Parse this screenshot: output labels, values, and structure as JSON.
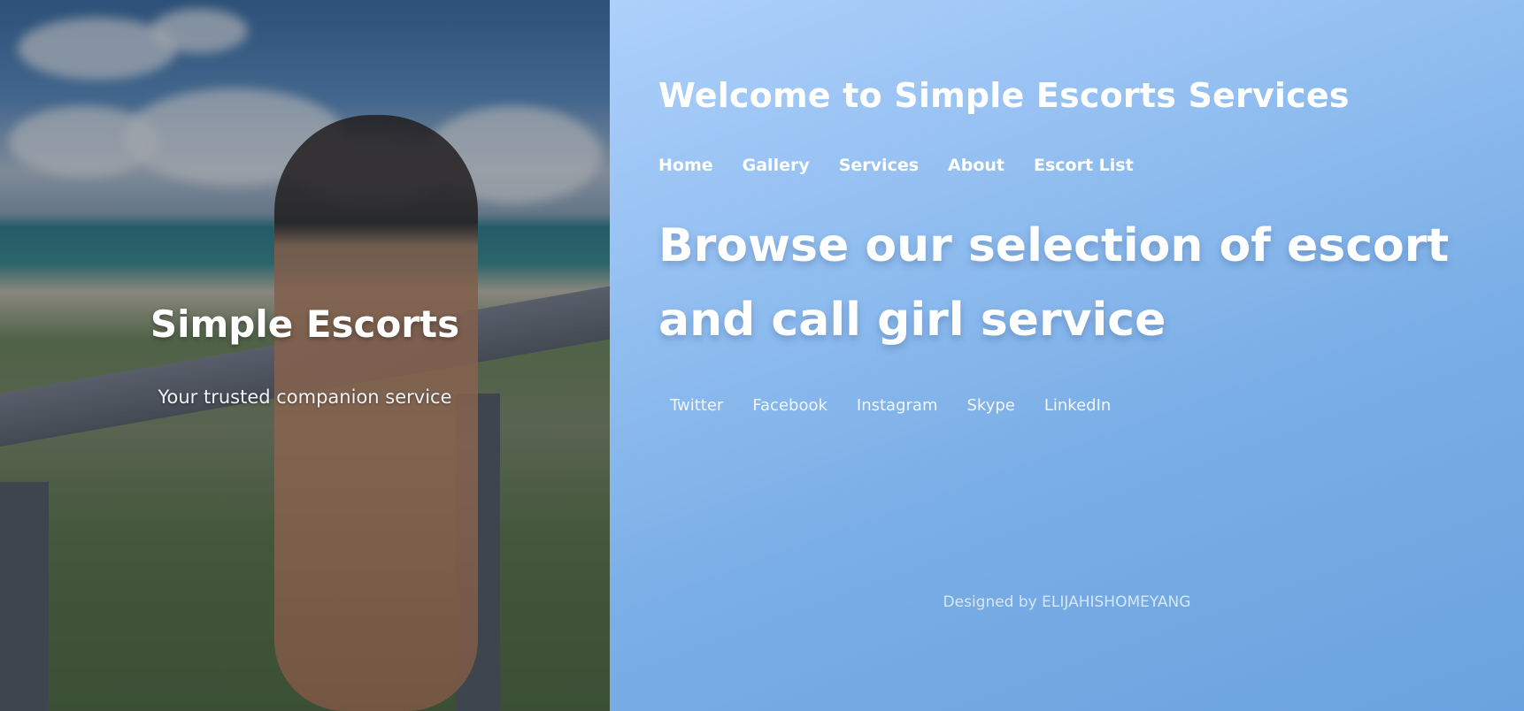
{
  "hero": {
    "title": "Simple Escorts",
    "subtitle": "Your trusted companion service"
  },
  "header": {
    "welcome": "Welcome to Simple Escorts Services"
  },
  "nav": {
    "items": [
      {
        "label": "Home"
      },
      {
        "label": "Gallery"
      },
      {
        "label": "Services"
      },
      {
        "label": "About"
      },
      {
        "label": "Escort List"
      }
    ]
  },
  "main": {
    "headline": "Browse our selection of escort and call girl service"
  },
  "social": {
    "links": [
      {
        "label": "Twitter"
      },
      {
        "label": "Facebook"
      },
      {
        "label": "Instagram"
      },
      {
        "label": "Skype"
      },
      {
        "label": "LinkedIn"
      }
    ]
  },
  "footer": {
    "credit": "Designed by ELIJAHISHOMEYANG"
  },
  "colors": {
    "panel_top": "#aed0fb",
    "panel_bottom": "#6aa3df",
    "text": "#ffffff"
  }
}
